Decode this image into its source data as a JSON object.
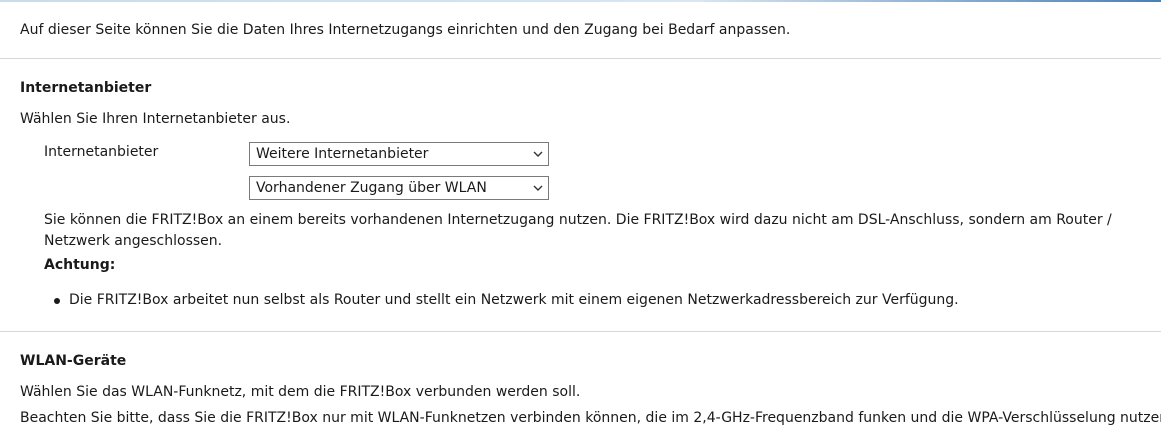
{
  "intro": "Auf dieser Seite können Sie die Daten Ihres Internetzugangs einrichten und den Zugang bei Bedarf anpassen.",
  "provider_section": {
    "heading": "Internetanbieter",
    "instruction": "Wählen Sie Ihren Internetanbieter aus.",
    "field_label": "Internetanbieter",
    "provider_select_value": "Weitere Internetanbieter",
    "access_select_value": "Vorhandener Zugang über WLAN",
    "info_text": "Sie können die FRITZ!Box an einem bereits vorhandenen Internetzugang nutzen. Die FRITZ!Box wird dazu nicht am DSL-Anschluss, sondern am Router / Netzwerk angeschlossen.",
    "warning_label": "Achtung:",
    "warning_items": [
      "Die FRITZ!Box arbeitet nun selbst als Router und stellt ein Netzwerk mit einem eigenen Netzwerkadressbereich zur Verfügung."
    ]
  },
  "wlan_section": {
    "heading": "WLAN-Geräte",
    "line1": "Wählen Sie das WLAN-Funknetz, mit dem die FRITZ!Box verbunden werden soll.",
    "line2": "Beachten Sie bitte, dass Sie die FRITZ!Box nur mit WLAN-Funknetzen verbinden können, die im 2,4-GHz-Frequenzband funken und die WPA-Verschlüsselung nutzen."
  },
  "icons": {
    "dropdown": "chevron-down-icon"
  }
}
